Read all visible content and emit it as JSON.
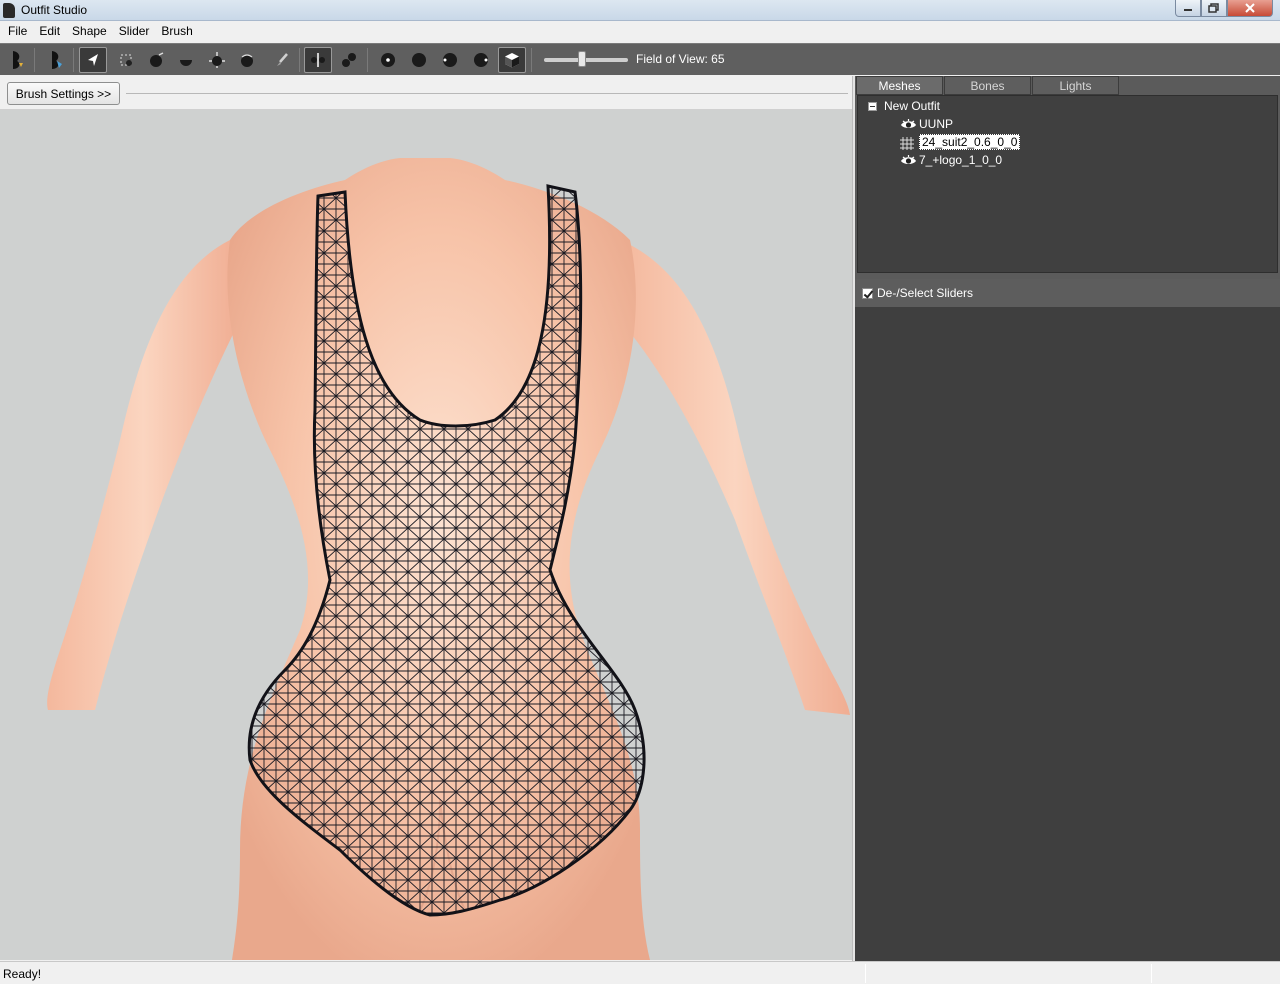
{
  "window": {
    "title": "Outfit Studio"
  },
  "menu": [
    "File",
    "Edit",
    "Shape",
    "Slider",
    "Brush"
  ],
  "toolbar": {
    "field_of_view_label": "Field of View: 65",
    "field_of_view_value": 65
  },
  "brush": {
    "settings_label": "Brush Settings >>"
  },
  "panel": {
    "tabs": [
      "Meshes",
      "Bones",
      "Lights"
    ],
    "active_tab": "Meshes",
    "tree_root": "New Outfit",
    "meshes": [
      {
        "label": "UUNP",
        "icon": "eye-icon",
        "selected": false
      },
      {
        "label": "24_suit2_0.6_0_0",
        "icon": "grid-icon",
        "selected": true
      },
      {
        "label": "7_+logo_1_0_0",
        "icon": "eye-icon",
        "selected": false
      }
    ],
    "sliders_header": "De-/Select Sliders"
  },
  "status": {
    "text": "Ready!"
  },
  "colors": {
    "toolbar_bg": "#5f5f5f",
    "viewport_bg": "#cfd1d0",
    "panel_dark": "#404040",
    "skin": "#f6c0a5",
    "wireframe": "#1a1a22"
  }
}
